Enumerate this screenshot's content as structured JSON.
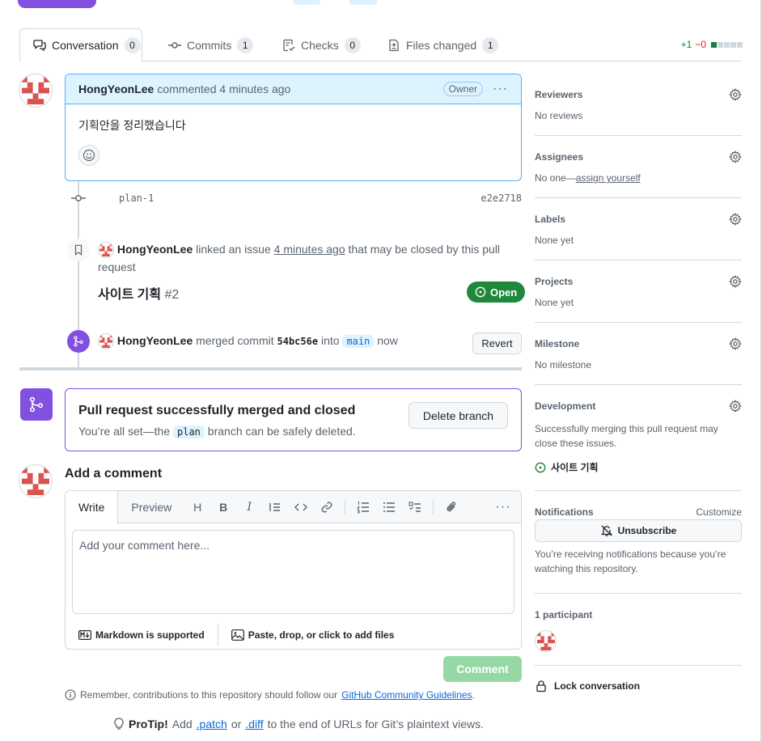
{
  "tabs": [
    {
      "label": "Conversation",
      "count": "0"
    },
    {
      "label": "Commits",
      "count": "1"
    },
    {
      "label": "Checks",
      "count": "0"
    },
    {
      "label": "Files changed",
      "count": "1"
    }
  ],
  "diffstat": {
    "added": "+1",
    "removed": "−0"
  },
  "comment": {
    "author": "HongYeonLee",
    "action": "commented 4 minutes ago",
    "role": "Owner",
    "body": "기획안을 정리했습니다"
  },
  "commit": {
    "branch_label": "plan-1",
    "sha": "e2e2718"
  },
  "linked_issue": {
    "author": "HongYeonLee",
    "pre": "linked an issue",
    "time": "4 minutes ago",
    "post": "that may be closed by this pull request",
    "title": "사이트 기획",
    "number": "#2",
    "state": "Open"
  },
  "merge_event": {
    "author": "HongYeonLee",
    "pre": "merged commit",
    "sha": "54bc56e",
    "into": "into",
    "branch": "main",
    "time": "now",
    "revert_label": "Revert"
  },
  "merged_box": {
    "title": "Pull request successfully merged and closed",
    "pre": "You’re all set—the",
    "branch": "plan",
    "post": "branch can be safely deleted.",
    "delete_label": "Delete branch"
  },
  "add_comment": {
    "title": "Add a comment",
    "tab_write": "Write",
    "tab_preview": "Preview",
    "placeholder": "Add your comment here...",
    "markdown_note": "Markdown is supported",
    "attach_note": "Paste, drop, or click to add files",
    "submit_label": "Comment"
  },
  "guidelines": {
    "text": "Remember, contributions to this repository should follow our",
    "link": "GitHub Community Guidelines",
    "end": "."
  },
  "protip": {
    "label": "ProTip!",
    "pre": "Add",
    "patch": ".patch",
    "or": "or",
    "diff": ".diff",
    "post": "to the end of URLs for Git’s plaintext views."
  },
  "sidebar": {
    "reviewers": {
      "title": "Reviewers",
      "value": "No reviews"
    },
    "assignees": {
      "title": "Assignees",
      "value": "No one—",
      "link": "assign yourself"
    },
    "labels": {
      "title": "Labels",
      "value": "None yet"
    },
    "projects": {
      "title": "Projects",
      "value": "None yet"
    },
    "milestone": {
      "title": "Milestone",
      "value": "No milestone"
    },
    "development": {
      "title": "Development",
      "value": "Successfully merging this pull request may close these issues.",
      "issue": "사이트 기획"
    },
    "notifications": {
      "title": "Notifications",
      "customize": "Customize",
      "unsubscribe": "Unsubscribe",
      "note": "You’re receiving notifications because you’re watching this repository."
    },
    "participants": {
      "title": "1 participant"
    },
    "lock": "Lock conversation"
  },
  "colors": {
    "accent_purple": "#8250df",
    "open_green": "#1f883d",
    "link_blue": "#0969da"
  }
}
